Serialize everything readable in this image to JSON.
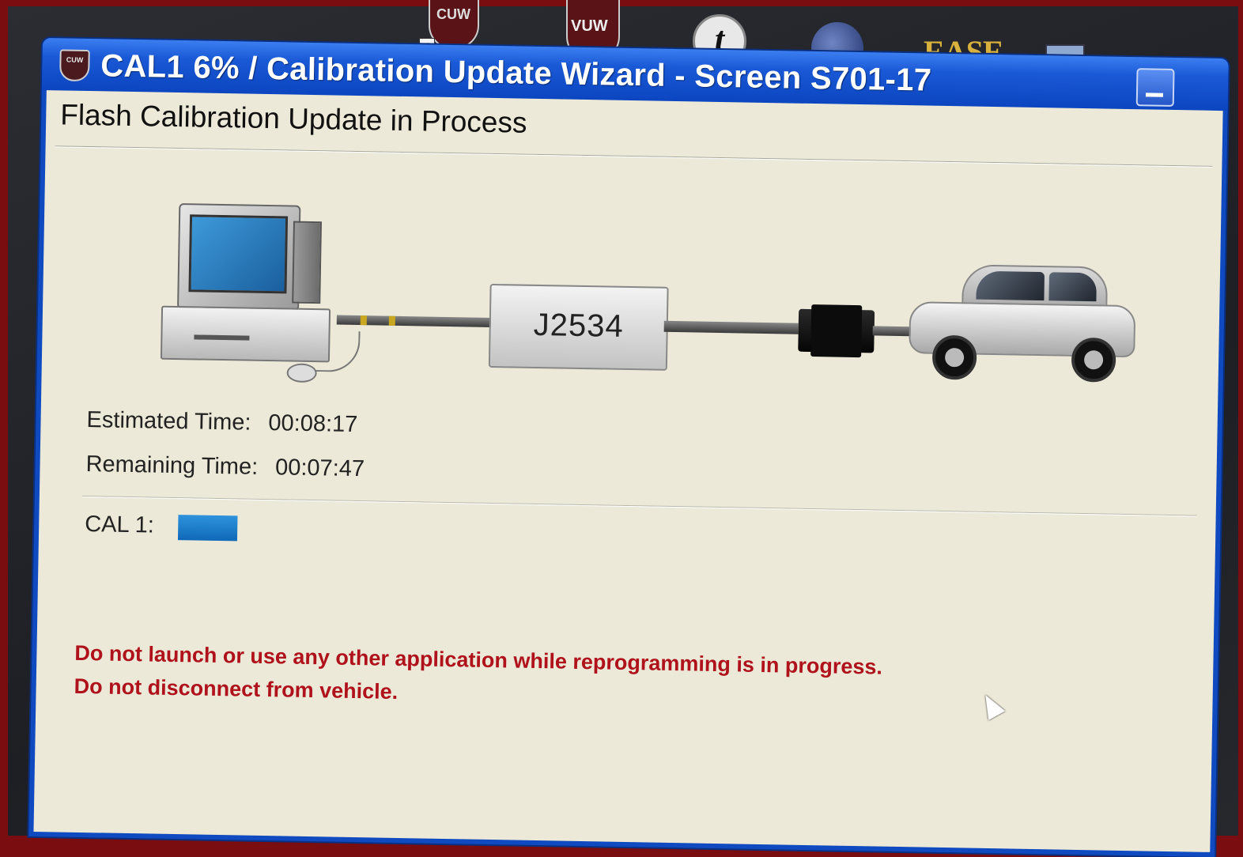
{
  "desktop": {
    "icons": [
      {
        "name": "cuw-shortcut",
        "label": "CUW"
      },
      {
        "name": "vuw-shortcut",
        "label": "VUW"
      },
      {
        "name": "t-shortcut",
        "label": "t"
      },
      {
        "name": "globe-shortcut",
        "label": ""
      },
      {
        "name": "ease-shortcut",
        "label": "EASE"
      },
      {
        "name": "tool-shortcut",
        "label": ""
      }
    ]
  },
  "window": {
    "title": "CAL1 6% / Calibration Update Wizard - Screen S701-17",
    "logo_text": "CUW",
    "heading": "Flash Calibration Update in Process"
  },
  "diagram": {
    "interface_label": "J2534"
  },
  "status": {
    "estimated_label": "Estimated Time:",
    "estimated_value": "00:08:17",
    "remaining_label": "Remaining Time:",
    "remaining_value": "00:07:47",
    "cal_label": "CAL 1:",
    "progress_percent": 6
  },
  "warnings": {
    "line1": "Do not launch or use any other application while reprogramming is in progress.",
    "line2": "Do not disconnect from vehicle."
  },
  "colors": {
    "titlebar": "#1a59d6",
    "progress": "#1a7fcc",
    "warning_text": "#b0121c",
    "client_bg": "#ece9d8"
  }
}
